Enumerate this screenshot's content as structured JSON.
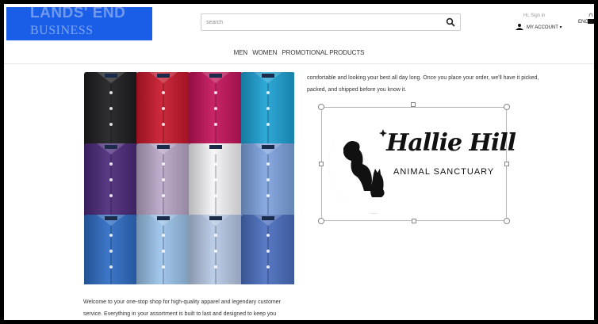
{
  "header": {
    "logo_line1": "LANDS' END",
    "logo_line2": "BUSINESS",
    "search": {
      "placeholder": "search"
    },
    "sign_in": "Hi, Sign in",
    "my_account": "MY ACCOUNT ▾",
    "language": "ENG"
  },
  "nav": {
    "items": [
      {
        "label": "MEN"
      },
      {
        "label": "WOMEN"
      },
      {
        "label": "PROMOTIONAL PRODUCTS"
      }
    ]
  },
  "content": {
    "intro_continued": "comfortable and looking your best all day long. Once you place your order, we'll have it picked, packed, and shipped before you know it.",
    "intro": "Welcome to your one-stop shop for high-quality apparel and legendary customer service. Everything in your assortment is built to last and designed to keep you",
    "uploaded_logo": {
      "name": "Hallie Hill",
      "subtitle": "ANIMAL SANCTUARY"
    }
  },
  "shirts": {
    "colors": [
      "#1d1d1f",
      "#c8182b",
      "#c4135a",
      "#1da2d4",
      "#4b2a7a",
      "#b9a7c7",
      "#f4f4f6",
      "#7fa4e0",
      "#2e6cc4",
      "#9bc3ea",
      "#b7c9e6",
      "#4b6fc0"
    ]
  },
  "colors": {
    "brand_blue": "#1a5ee8",
    "background_frame": "#000000"
  },
  "icons": {
    "search": "search-icon",
    "user": "user-icon",
    "bag": "bag-icon"
  }
}
